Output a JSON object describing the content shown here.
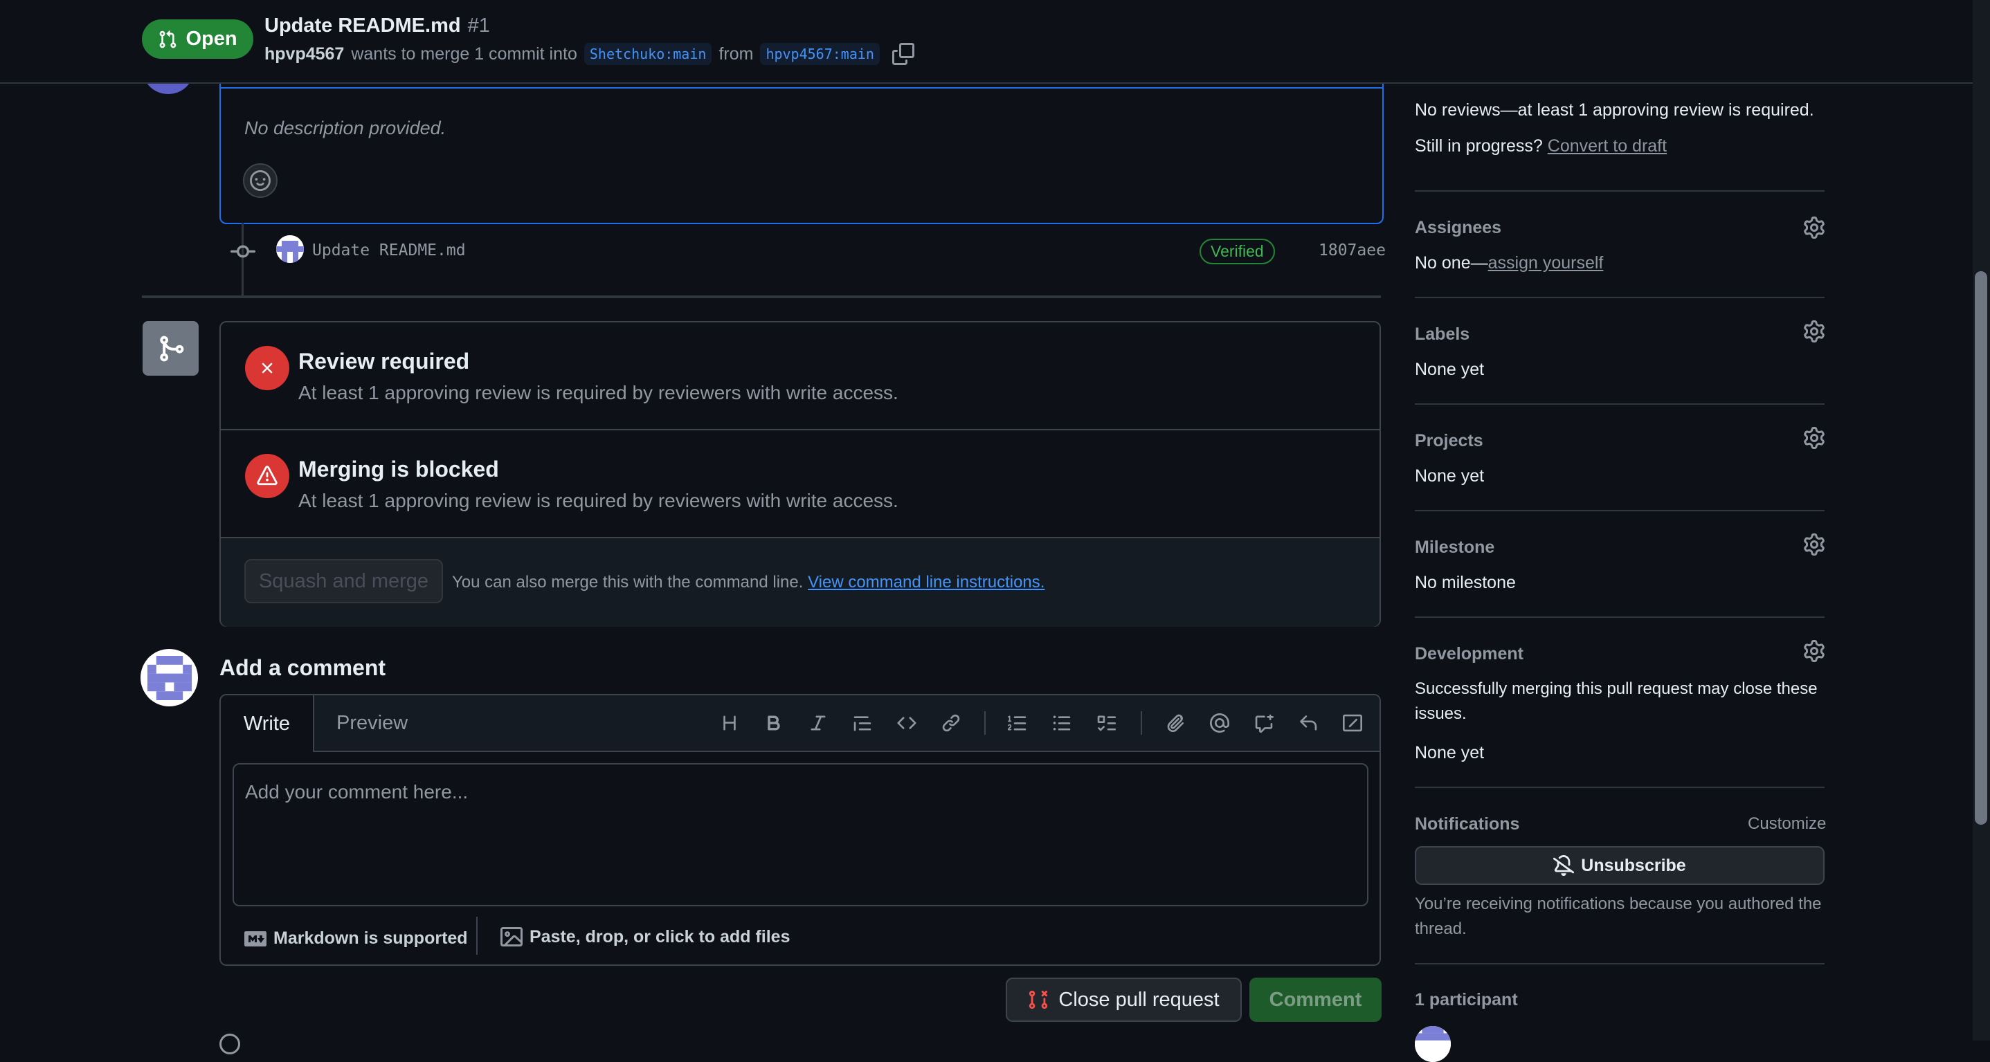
{
  "header": {
    "state_label": "Open",
    "title": "Update README.md",
    "number": "#1",
    "author": "hpvp4567",
    "merge_text": "wants to merge 1 commit into",
    "base_branch": "Shetchuko:main",
    "from_text": "from",
    "head_branch": "hpvp4567:main"
  },
  "description": {
    "text": "No description provided."
  },
  "commit": {
    "message": "Update README.md",
    "badge": "Verified",
    "sha": "1807aee"
  },
  "merge_box": {
    "review_title": "Review required",
    "review_desc": "At least 1 approving review is required by reviewers with write access.",
    "blocked_title": "Merging is blocked",
    "blocked_desc": "At least 1 approving review is required by reviewers with write access.",
    "merge_button": "Squash and merge",
    "cli_text": "You can also merge this with the command line.",
    "cli_link": "View command line instructions."
  },
  "comment": {
    "heading": "Add a comment",
    "tab_write": "Write",
    "tab_preview": "Preview",
    "placeholder": "Add your comment here...",
    "markdown_label": "Markdown is supported",
    "files_label": "Paste, drop, or click to add files",
    "close_button": "Close pull request",
    "comment_button": "Comment",
    "toolbar_icons": [
      "heading-icon",
      "bold-icon",
      "italic-icon",
      "quote-icon",
      "code-icon",
      "link-icon",
      "ordered-list-icon",
      "unordered-list-icon",
      "task-list-icon",
      "attach-icon",
      "mention-icon",
      "cross-reference-icon",
      "saved-reply-icon",
      "slash-command-icon"
    ]
  },
  "sidebar": {
    "reviewers_text": "No reviews—at least 1 approving review is required.",
    "progress_text": "Still in progress?",
    "convert_link": "Convert to draft",
    "assignees_title": "Assignees",
    "assignees_text": "No one—",
    "assign_link": "assign yourself",
    "labels_title": "Labels",
    "labels_text": "None yet",
    "projects_title": "Projects",
    "projects_text": "None yet",
    "milestone_title": "Milestone",
    "milestone_text": "No milestone",
    "development_title": "Development",
    "development_text_1": "Successfully merging this pull request may close these",
    "development_text_2": "issues.",
    "development_none": "None yet",
    "notifications_title": "Notifications",
    "customize": "Customize",
    "unsubscribe": "Unsubscribe",
    "notif_text_1": "You’re receiving notifications because you authored the",
    "notif_text_2": "thread.",
    "participants": "1 participant"
  },
  "colors": {
    "background": "#0d1117",
    "open_green": "#238636",
    "danger_red": "#da3633",
    "link_blue": "#4493f8",
    "border": "#30363d"
  }
}
